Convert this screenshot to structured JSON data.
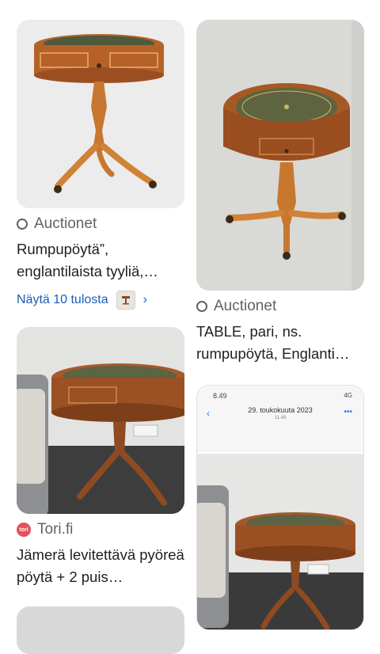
{
  "results": {
    "left": [
      {
        "source": "Auctionet",
        "title": "Rumpupöytä”, englantilaista tyyliä,…",
        "more_label": "Näytä 10 tulosta"
      },
      {
        "source": "Tori.fi",
        "source_badge": "tori",
        "title": "Jämerä levitettävä pyöreä pöytä + 2 puis…"
      }
    ],
    "right": [
      {
        "source": "Auctionet",
        "title": "TABLE, pari, ns. rumpupöytä, Englanti…"
      },
      {
        "phone_time": "8.49",
        "phone_status": "4G",
        "phone_date": "29. toukokuuta 2023",
        "phone_date_sub": "11.48"
      }
    ]
  },
  "colors": {
    "link": "#1a5fb4",
    "source_text": "#5f6368",
    "tori_brand": "#e4505a"
  },
  "icons": [
    "auctionet-logo-icon",
    "tori-logo-icon",
    "chevron-right-icon",
    "table-thumbnail-icon",
    "back-icon",
    "menu-dots-icon"
  ]
}
